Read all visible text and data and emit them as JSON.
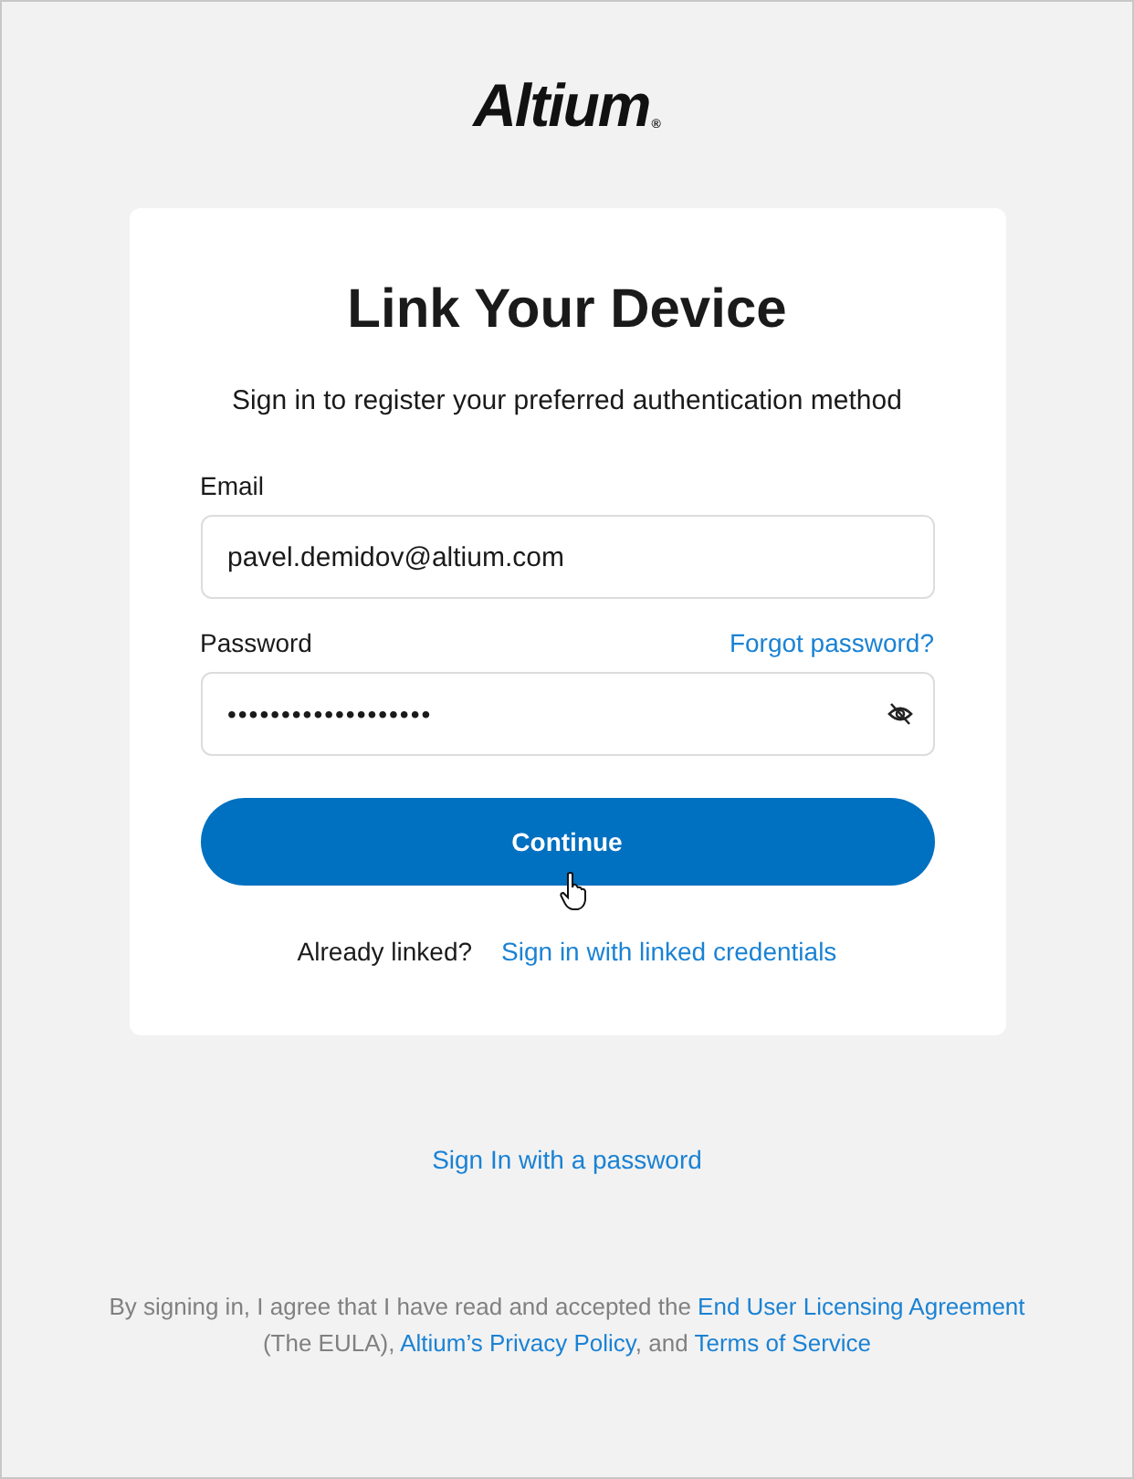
{
  "logo": {
    "text": "Altium",
    "mark": "®"
  },
  "card": {
    "title": "Link Your Device",
    "subtitle": "Sign in to register your preferred authentication method",
    "email": {
      "label": "Email",
      "value": "pavel.demidov@altium.com"
    },
    "password": {
      "label": "Password",
      "forgot_link": "Forgot password?",
      "value": "•••••••••••••••••••"
    },
    "continue_button": "Continue",
    "linked": {
      "text": "Already linked?",
      "link": "Sign in with linked credentials"
    }
  },
  "password_link": "Sign In with a password",
  "footer": [
    {
      "text": "By signing in, I agree that I have read and accepted the ",
      "link": false
    },
    {
      "text": "End User Licensing Agreement",
      "link": true
    },
    {
      "text": " (The EULA), ",
      "link": false
    },
    {
      "text": "Altium’s Privacy Policy",
      "link": true
    },
    {
      "text": ", and ",
      "link": false
    },
    {
      "text": "Terms of Service",
      "link": true
    }
  ]
}
